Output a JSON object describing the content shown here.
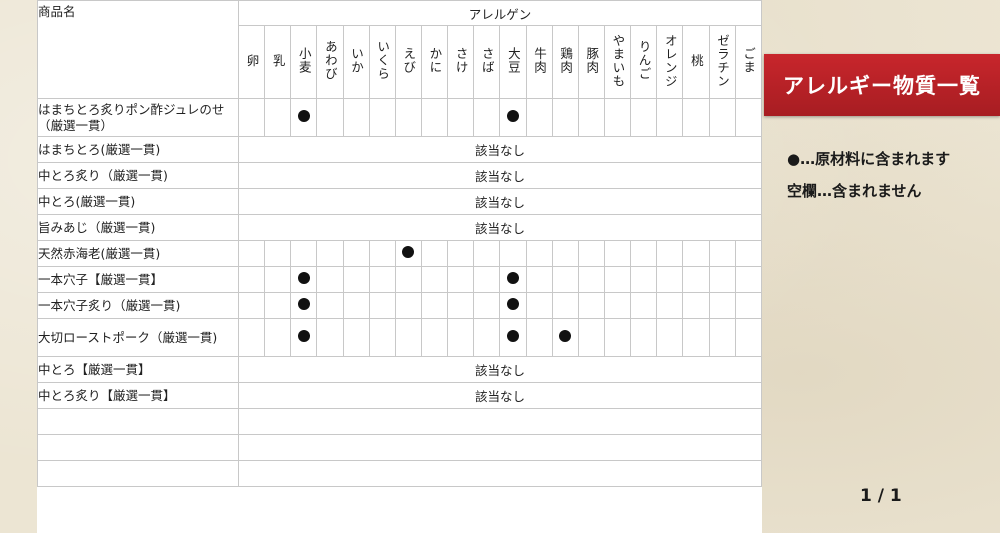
{
  "table": {
    "product_header": "商品名",
    "allergen_header": "アレルゲン",
    "allergens": [
      "卵",
      "乳",
      "小麦",
      "あわび",
      "いか",
      "いくら",
      "えび",
      "かに",
      "さけ",
      "さば",
      "大豆",
      "牛肉",
      "鶏肉",
      "豚肉",
      "やまいも",
      "りんご",
      "オレンジ",
      "桃",
      "ゼラチン",
      "ごま"
    ],
    "rows": [
      {
        "name": "はまちとろ炙りポン酢ジュレのせ（厳選一貫）",
        "marks": [
          "小麦",
          "大豆"
        ]
      },
      {
        "name": "はまちとろ(厳選一貫)",
        "none": "該当なし"
      },
      {
        "name": "中とろ炙り（厳選一貫)",
        "none": "該当なし"
      },
      {
        "name": "中とろ(厳選一貫)",
        "none": "該当なし"
      },
      {
        "name": "旨みあじ（厳選一貫)",
        "none": "該当なし"
      },
      {
        "name": "天然赤海老(厳選一貫)",
        "marks": [
          "えび"
        ]
      },
      {
        "name": "一本穴子【厳選一貫】",
        "marks": [
          "小麦",
          "大豆"
        ]
      },
      {
        "name": "一本穴子炙り（厳選一貫)",
        "marks": [
          "小麦",
          "大豆"
        ]
      },
      {
        "name": "大切ローストポーク（厳選一貫)",
        "marks": [
          "小麦",
          "大豆",
          "鶏肉"
        ]
      },
      {
        "name": "中とろ【厳選一貫】",
        "none": "該当なし"
      },
      {
        "name": "中とろ炙り【厳選一貫】",
        "none": "該当なし"
      }
    ],
    "empty_rows": 3
  },
  "side": {
    "title": "アレルギー物質一覧",
    "legend_dot": "●…原材料に含まれます",
    "legend_blank": "空欄…含まれません",
    "pager": "1 / 1"
  }
}
